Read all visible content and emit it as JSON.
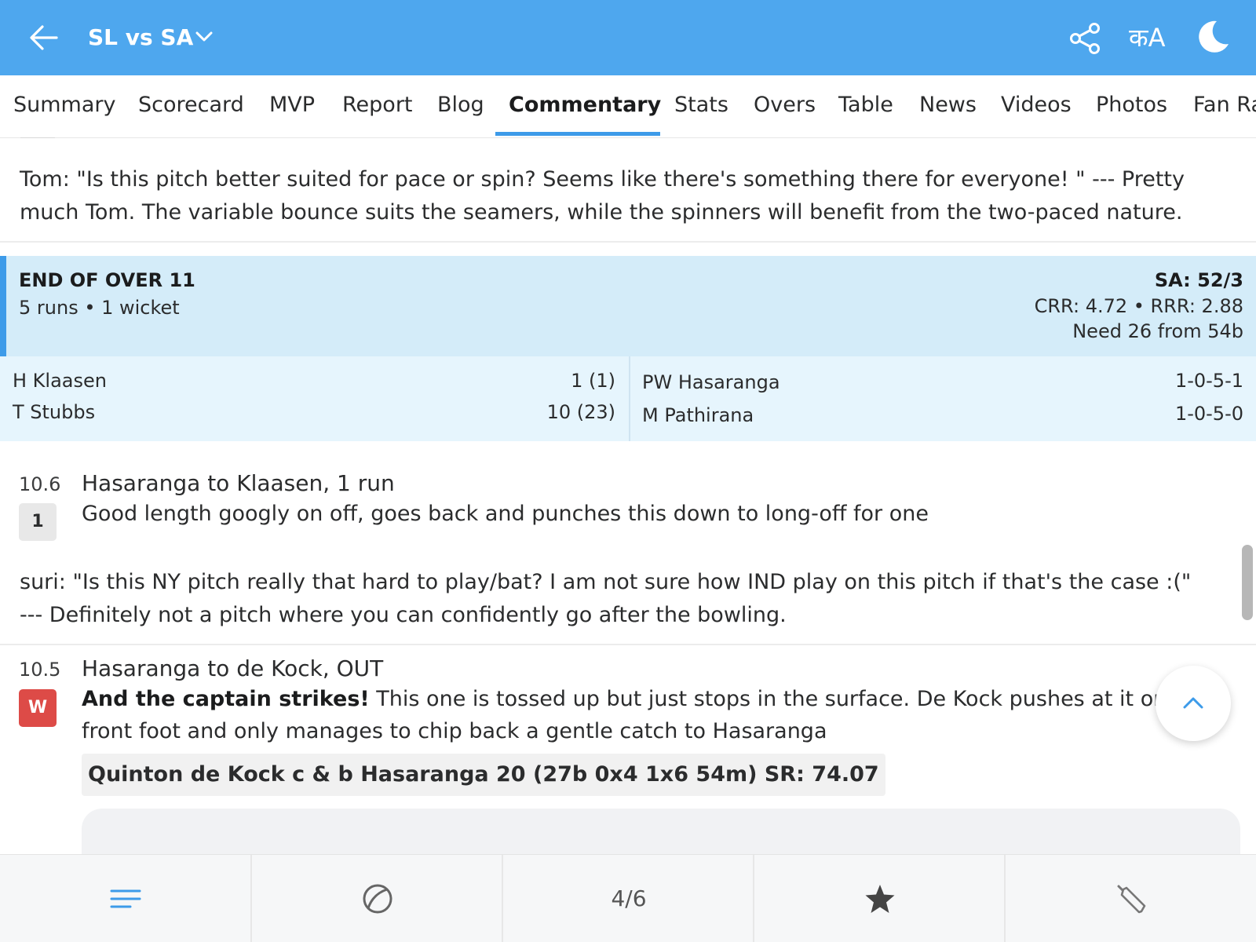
{
  "header": {
    "match_title": "SL vs SA",
    "language_label": "कA"
  },
  "tabs": [
    {
      "label": "Summary"
    },
    {
      "label": "Scorecard"
    },
    {
      "label": "MVP"
    },
    {
      "label": "Report"
    },
    {
      "label": "Blog"
    },
    {
      "label": "Commentary",
      "active": true
    },
    {
      "label": "Stats"
    },
    {
      "label": "Overs"
    },
    {
      "label": "Table"
    },
    {
      "label": "News"
    },
    {
      "label": "Videos"
    },
    {
      "label": "Photos"
    },
    {
      "label": "Fan Ra"
    }
  ],
  "comments": {
    "tom": "Tom: \"Is this pitch better suited for pace or spin? Seems like there's something there for everyone! \" --- Pretty much Tom. The variable bounce suits the seamers, while the spinners will benefit from the two-paced nature.",
    "suri": "suri: \"Is this NY pitch really that hard to play/bat? I am not sure how IND play on this pitch if that's the case :(\" --- Definitely not a pitch where you can confidently go after the bowling."
  },
  "end_of_over": {
    "title": "END OF OVER 11",
    "summary": "5 runs • 1 wicket",
    "score": "SA: 52/3",
    "rates": "CRR: 4.72 • RRR: 2.88",
    "need": "Need 26 from 54b",
    "batters": [
      {
        "name": "H Klaasen",
        "stat": "1 (1)"
      },
      {
        "name": "T Stubbs",
        "stat": "10 (23)"
      }
    ],
    "bowlers": [
      {
        "name": "PW Hasaranga",
        "stat": "1-0-5-1"
      },
      {
        "name": "M Pathirana",
        "stat": "1-0-5-0"
      }
    ]
  },
  "balls": [
    {
      "number": "10.6",
      "badge": "1",
      "headline": "Hasaranga to Klaasen, 1 run",
      "text": "Good length googly on off, goes back and punches this down to long-off for one"
    },
    {
      "number": "10.5",
      "badge": "W",
      "headline": "Hasaranga to de Kock, OUT",
      "text_bold": "And the captain strikes!",
      "text": " This one is tossed up but just stops in the surface. De Kock pushes at it on the front foot and only manages to chip back a gentle catch to Hasaranga",
      "dismissal": "Quinton de Kock c & b Hasaranga 20 (27b 0x4 1x6 54m) SR: 74.07"
    }
  ],
  "bottom_bar": {
    "counter": "4/6"
  },
  "colors": {
    "header_bg": "#4ea7ee",
    "accent": "#3d9be9",
    "eoo_bg": "#d4ecf9",
    "eoo_stats_bg": "#e6f5fd",
    "wicket": "#dd4b47"
  },
  "icons": {
    "back": "arrow-left-icon",
    "chevron": "chevron-down-icon",
    "share": "share-icon",
    "theme": "moon-icon",
    "scroll_top": "chevron-up-icon",
    "nav_list": "list-icon",
    "nav_ball": "cricket-ball-icon",
    "nav_star": "star-icon",
    "nav_bat": "cricket-bat-icon"
  }
}
